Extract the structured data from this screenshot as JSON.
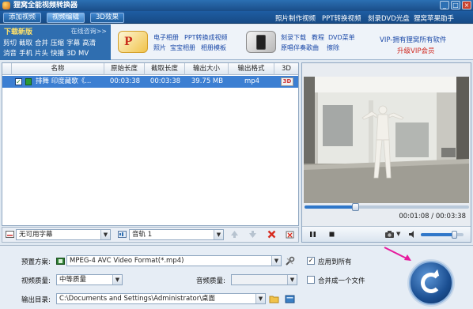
{
  "window": {
    "title": "狸窝全能视频转换器",
    "controls": [
      "_",
      "□",
      "×"
    ]
  },
  "tabs": [
    {
      "label": "添加视频",
      "active": false
    },
    {
      "label": "视频编辑",
      "active": true
    },
    {
      "label": "3D效果",
      "active": false
    }
  ],
  "top_links": [
    "照片制作视频",
    "PPT转换视频",
    "刻录DVD光盘",
    "狸窝苹果助手"
  ],
  "ribbon": {
    "download_title": "下载新版",
    "online_help": "在线咨询>>",
    "tools_row1": [
      "剪切",
      "截取",
      "合并",
      "压缩",
      "字幕",
      "高清"
    ],
    "tools_row2": [
      "消音",
      "手机",
      "片头",
      "快播",
      "3D",
      "MV"
    ],
    "group1": [
      "电子相册",
      "PPT转换成视频",
      "照片",
      "宝宝相册",
      "相册模板"
    ],
    "group2": [
      "刻录下载",
      "教程",
      "DVD菜单",
      "原唱伴奏歌曲",
      "擦除"
    ],
    "vip_line": "VIP-拥有狸窝所有软件",
    "vip_upgrade": "升级VIP会员"
  },
  "file_list": {
    "columns": [
      "名称",
      "原始长度",
      "截取长度",
      "输出大小",
      "输出格式",
      "3D"
    ],
    "rows": [
      {
        "name": "排舞 印度藏歌《...",
        "original": "00:03:38",
        "clip": "00:03:38",
        "size": "39.75 MB",
        "format": "mp4",
        "checked": true
      }
    ]
  },
  "list_toolbar": {
    "subtitle": "无可用字幕",
    "audio_track": "音轨 1"
  },
  "player": {
    "current_time": "00:01:08",
    "total_time": "00:03:38",
    "progress_fraction": 0.31,
    "volume_fraction": 0.8,
    "separator": "/"
  },
  "settings": {
    "preset_label": "预置方案:",
    "preset_value": "MPEG-4 AVC Video Format(*.mp4)",
    "apply_all_label": "应用到所有",
    "apply_all_checked": true,
    "video_quality_label": "视频质量:",
    "video_quality_value": "中等质量",
    "audio_quality_label": "音频质量:",
    "audio_quality_value": "",
    "merge_label": "合并成一个文件",
    "merge_checked": false,
    "output_label": "输出目录:",
    "output_path": "C:\\Documents and Settings\\Administrator\\桌面"
  },
  "colors": {
    "accent": "#2f6eb0",
    "selection": "#3c7fd2",
    "vip_red": "#d0281f",
    "link_blue": "#1b49a8",
    "arrow_magenta": "#e61b9d"
  }
}
